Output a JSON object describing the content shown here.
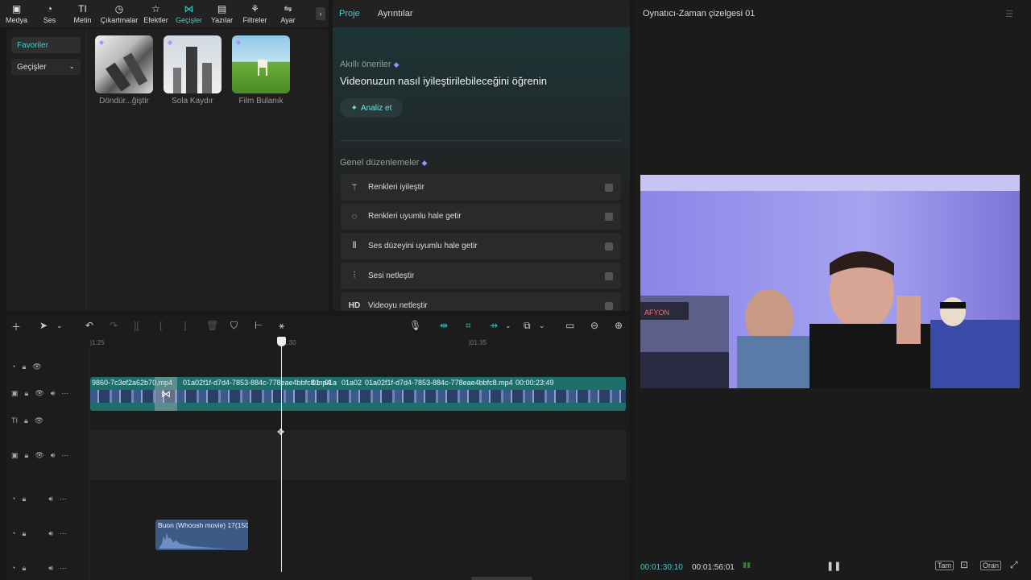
{
  "toolbar": {
    "items": [
      {
        "label": "Medya",
        "icon": "media-icon"
      },
      {
        "label": "Ses",
        "icon": "audio-icon"
      },
      {
        "label": "Metin",
        "icon": "text-icon"
      },
      {
        "label": "Çıkartmalar",
        "icon": "sticker-icon"
      },
      {
        "label": "Efektler",
        "icon": "effects-icon"
      },
      {
        "label": "Geçişler",
        "icon": "transitions-icon"
      },
      {
        "label": "Yazılar",
        "icon": "captions-icon"
      },
      {
        "label": "Filtreler",
        "icon": "filters-icon"
      },
      {
        "label": "Ayar",
        "icon": "adjust-icon"
      }
    ],
    "active": "Geçişler"
  },
  "library": {
    "favorites_label": "Favoriler",
    "category_label": "Geçişler",
    "items": [
      {
        "label": "Döndür...ğiştir"
      },
      {
        "label": "Sola Kaydır"
      },
      {
        "label": "Film Bulanık"
      }
    ]
  },
  "details": {
    "tabs": [
      "Proje",
      "Ayrıntılar"
    ],
    "smart_label": "Akıllı öneriler",
    "smart_title": "Videonuzun nasıl iyileştirilebileceğini öğrenin",
    "analyze_label": "Analiz et",
    "general_label": "Genel düzenlemeler",
    "options": [
      {
        "label": "Renkleri iyileştir",
        "icon": "magic-wand-icon"
      },
      {
        "label": "Renkleri uyumlu hale getir",
        "icon": "color-match-icon"
      },
      {
        "label": "Ses düzeyini uyumlu hale getir",
        "icon": "sliders-icon"
      },
      {
        "label": "Sesi netleştir",
        "icon": "waveform-icon"
      },
      {
        "label": "Videoyu netleştir",
        "icon": "hd-icon"
      }
    ]
  },
  "player": {
    "title": "Oynatıcı-Zaman çizelgesi 01",
    "current_time": "00:01:30:10",
    "total_time": "00:01:56:01",
    "full_label": "Tam",
    "ratio_label": "Oran",
    "video_overlay_text": "AFYON"
  },
  "timeline": {
    "ruler": [
      "|1:25",
      "1:30",
      "|01:35"
    ],
    "clips": {
      "clip1": "9860-7c3ef2a62b70.mp4",
      "clip2": "01a02f1f-d7d4-7853-884c-778eae4bbfc8.mp4",
      "clip3": "01",
      "clip4": "01a",
      "clip5": "01a02",
      "clip6": "01a02f1f-d7d4-7853-884c-778eae4bbfc8.mp4",
      "clip6_duration": "00:00:23:49"
    },
    "audio_clip": "Buon (Whoosh movie) 17(150..."
  }
}
